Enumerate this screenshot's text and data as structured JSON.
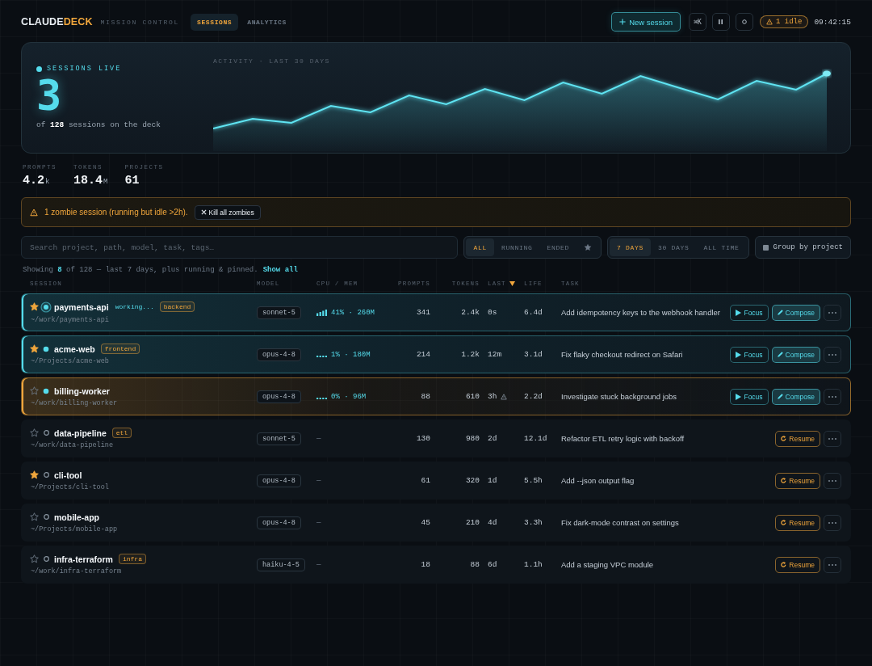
{
  "header": {
    "logo": {
      "primary": "CLAUDE",
      "accent": "DECK"
    },
    "tagline": "MISSION CONTROL",
    "nav": [
      {
        "label": "SESSIONS",
        "selected": true
      },
      {
        "label": "ANALYTICS",
        "selected": false
      }
    ],
    "new_session": "New session",
    "shortcut": "⌘K",
    "idle_badge": "1 idle",
    "clock": "09:42:15"
  },
  "hero": {
    "live_label": "SESSIONS LIVE",
    "live_count": "3",
    "summary": "of **128** sessions on the deck",
    "chart_label": "ACTIVITY · LAST 30 DAYS"
  },
  "stats": [
    {
      "label": "PROMPTS",
      "value": "4.2",
      "unit": "k"
    },
    {
      "label": "TOKENS",
      "value": "18.4",
      "unit": "M"
    },
    {
      "label": "PROJECTS",
      "value": "61"
    }
  ],
  "alert": {
    "message": "1 zombie session (running but idle >2h).",
    "action": "Kill all zombies"
  },
  "filters": {
    "search": {
      "placeholder": "Search project, path, model, task, tags…"
    },
    "status": [
      {
        "kind": "text",
        "label": "ALL",
        "selected": true
      },
      {
        "kind": "text",
        "label": "RUNNING",
        "selected": false
      },
      {
        "kind": "text",
        "label": "ENDED",
        "selected": false
      },
      {
        "kind": "star",
        "selected": false
      }
    ],
    "range": [
      {
        "label": "7 DAYS",
        "selected": true
      },
      {
        "label": "30 DAYS",
        "selected": false
      },
      {
        "label": "ALL TIME",
        "selected": false
      }
    ],
    "group": {
      "label": "Group by project",
      "checked": false
    }
  },
  "summary": {
    "text": "Showing **8** of 128 — last 7 days, plus running & pinned.",
    "link": "Show all"
  },
  "table": {
    "columns": [
      {
        "label": "SESSION",
        "sorted": false
      },
      {
        "label": "MODEL",
        "sorted": false
      },
      {
        "label": "CPU / MEM",
        "sorted": false
      },
      {
        "label": "PROMPTS",
        "sorted": false
      },
      {
        "label": "TOKENS",
        "sorted": false
      },
      {
        "label": "LAST",
        "sorted": true
      },
      {
        "label": "LIFE",
        "sorted": false
      },
      {
        "label": "TASK",
        "sorted": false
      }
    ],
    "rows": [
      {
        "kind": "working",
        "name": "payments-api",
        "starred": true,
        "activity": "working...",
        "tag": "backend",
        "path": "~/work/payments-api",
        "model": "sonnet-5",
        "cpu_mem": "41% · 260M",
        "prompts": "341",
        "tokens": "2.4k",
        "last": "0s",
        "last_warning": false,
        "life": "6.4d",
        "task": "Add idempotency keys to the webhook handler",
        "actions": [
          {
            "kind": "focus",
            "label": "Focus"
          },
          {
            "kind": "compose",
            "label": "Compose"
          },
          {
            "kind": "more"
          }
        ]
      },
      {
        "kind": "running",
        "name": "acme-web",
        "starred": true,
        "tag": "frontend",
        "path": "~/Projects/acme-web",
        "model": "opus-4-8",
        "cpu_mem": "1% · 180M",
        "prompts": "214",
        "tokens": "1.2k",
        "last": "12m",
        "last_warning": false,
        "life": "3.1d",
        "task": "Fix flaky checkout redirect on Safari",
        "actions": [
          {
            "kind": "focus",
            "label": "Focus"
          },
          {
            "kind": "compose",
            "label": "Compose"
          },
          {
            "kind": "more"
          }
        ]
      },
      {
        "kind": "zombie",
        "name": "billing-worker",
        "starred": false,
        "path": "~/work/billing-worker",
        "model": "opus-4-8",
        "cpu_mem": "0% · 96M",
        "prompts": "88",
        "tokens": "610",
        "last": "3h",
        "last_warning": true,
        "life": "2.2d",
        "task": "Investigate stuck background jobs",
        "actions": [
          {
            "kind": "focus",
            "label": "Focus"
          },
          {
            "kind": "compose",
            "label": "Compose"
          },
          {
            "kind": "more"
          }
        ]
      },
      {
        "kind": "ended",
        "name": "data-pipeline",
        "starred": false,
        "tag": "etl",
        "path": "~/work/data-pipeline",
        "model": "sonnet-5",
        "cpu_mem": "—",
        "prompts": "130",
        "tokens": "980",
        "last": "2d",
        "last_warning": false,
        "life": "12.1d",
        "task": "Refactor ETL retry logic with backoff",
        "actions": [
          {
            "kind": "resume",
            "label": "Resume"
          },
          {
            "kind": "more"
          }
        ]
      },
      {
        "kind": "ended",
        "name": "cli-tool",
        "starred": true,
        "path": "~/Projects/cli-tool",
        "model": "opus-4-8",
        "cpu_mem": "—",
        "prompts": "61",
        "tokens": "320",
        "last": "1d",
        "last_warning": false,
        "life": "5.5h",
        "task": "Add --json output flag",
        "actions": [
          {
            "kind": "resume",
            "label": "Resume"
          },
          {
            "kind": "more"
          }
        ]
      },
      {
        "kind": "ended",
        "name": "mobile-app",
        "starred": false,
        "path": "~/Projects/mobile-app",
        "model": "opus-4-8",
        "cpu_mem": "—",
        "prompts": "45",
        "tokens": "210",
        "last": "4d",
        "last_warning": false,
        "life": "3.3h",
        "task": "Fix dark-mode contrast on settings",
        "actions": [
          {
            "kind": "resume",
            "label": "Resume"
          },
          {
            "kind": "more"
          }
        ]
      },
      {
        "kind": "ended",
        "name": "infra-terraform",
        "starred": false,
        "tag": "infra",
        "path": "~/work/infra-terraform",
        "model": "haiku-4-5",
        "cpu_mem": "—",
        "prompts": "18",
        "tokens": "88",
        "last": "6d",
        "last_warning": false,
        "life": "1.1h",
        "task": "Add a staging VPC module",
        "actions": [
          {
            "kind": "resume",
            "label": "Resume"
          },
          {
            "kind": "more"
          }
        ]
      }
    ]
  }
}
